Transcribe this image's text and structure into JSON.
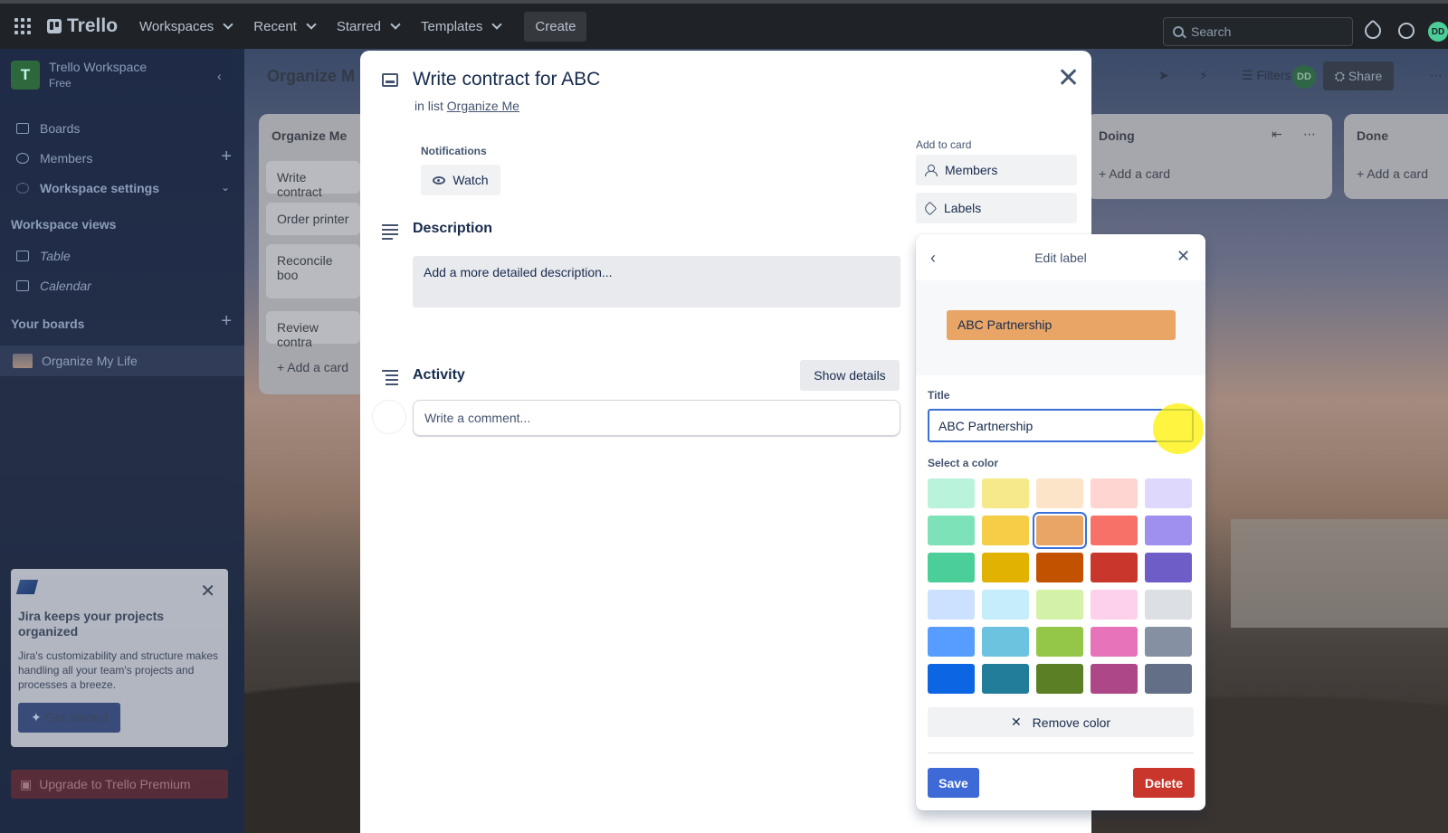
{
  "topbar": {
    "logo": "Trello",
    "nav": [
      "Workspaces",
      "Recent",
      "Starred",
      "Templates"
    ],
    "create": "Create",
    "search_placeholder": "Search",
    "avatar": "DD"
  },
  "sidebar": {
    "workspace_initial": "T",
    "workspace_name": "Trello Workspace",
    "workspace_plan": "Free",
    "items": [
      {
        "label": "Boards"
      },
      {
        "label": "Members"
      },
      {
        "label": "Workspace settings"
      }
    ],
    "views_title": "Workspace views",
    "views": [
      {
        "label": "Table"
      },
      {
        "label": "Calendar"
      }
    ],
    "boards_title": "Your boards",
    "board": "Organize My Life",
    "jira": {
      "title": "Jira keeps your projects organized",
      "body": "Jira's customizability and structure makes handling all your team's projects and processes a breeze.",
      "cta": "Get started"
    },
    "upgrade": "Upgrade to Trello Premium"
  },
  "board": {
    "title": "Organize M",
    "filters": "Filters",
    "share": "Share",
    "avatar": "DD",
    "lists": [
      {
        "title": "Organize Me",
        "cards": [
          "Write contract",
          "Order printer",
          "Reconcile boo",
          "Review contra"
        ],
        "add": "Add a card"
      },
      {
        "title": "Doing",
        "add": "Add a card"
      },
      {
        "title": "Done",
        "add": "Add a card"
      }
    ]
  },
  "card": {
    "title": "Write contract for ABC",
    "in_list_prefix": "in list",
    "list_name": "Organize Me",
    "notifications_label": "Notifications",
    "watch": "Watch",
    "description_title": "Description",
    "description_placeholder": "Add a more detailed description...",
    "activity_title": "Activity",
    "show_details": "Show details",
    "comment_placeholder": "Write a comment...",
    "add_to_card": "Add to card",
    "members": "Members",
    "labels": "Labels"
  },
  "edit_label": {
    "title": "Edit label",
    "preview_text": "ABC Partnership",
    "preview_color": "#e8a566",
    "title_label": "Title",
    "title_value": "ABC Partnership",
    "select_color_label": "Select a color",
    "selected_index": 7,
    "colors": [
      "#baf3db",
      "#f5e989",
      "#fce4c9",
      "#ffd5d2",
      "#dfd8fd",
      "#7ee2b8",
      "#f5cd47",
      "#e8a566",
      "#f87168",
      "#9f8fef",
      "#4bce97",
      "#e2b203",
      "#c25100",
      "#c9372c",
      "#6e5dc6",
      "#cce0ff",
      "#c6edfb",
      "#d3f1a7",
      "#fdd0ec",
      "#dcdfe4",
      "#579dff",
      "#6cc3e0",
      "#94c748",
      "#e774bb",
      "#8590a2",
      "#0c66e4",
      "#227d9b",
      "#5b7f24",
      "#ae4787",
      "#626f86"
    ],
    "remove_color": "Remove color",
    "save": "Save",
    "delete": "Delete"
  }
}
